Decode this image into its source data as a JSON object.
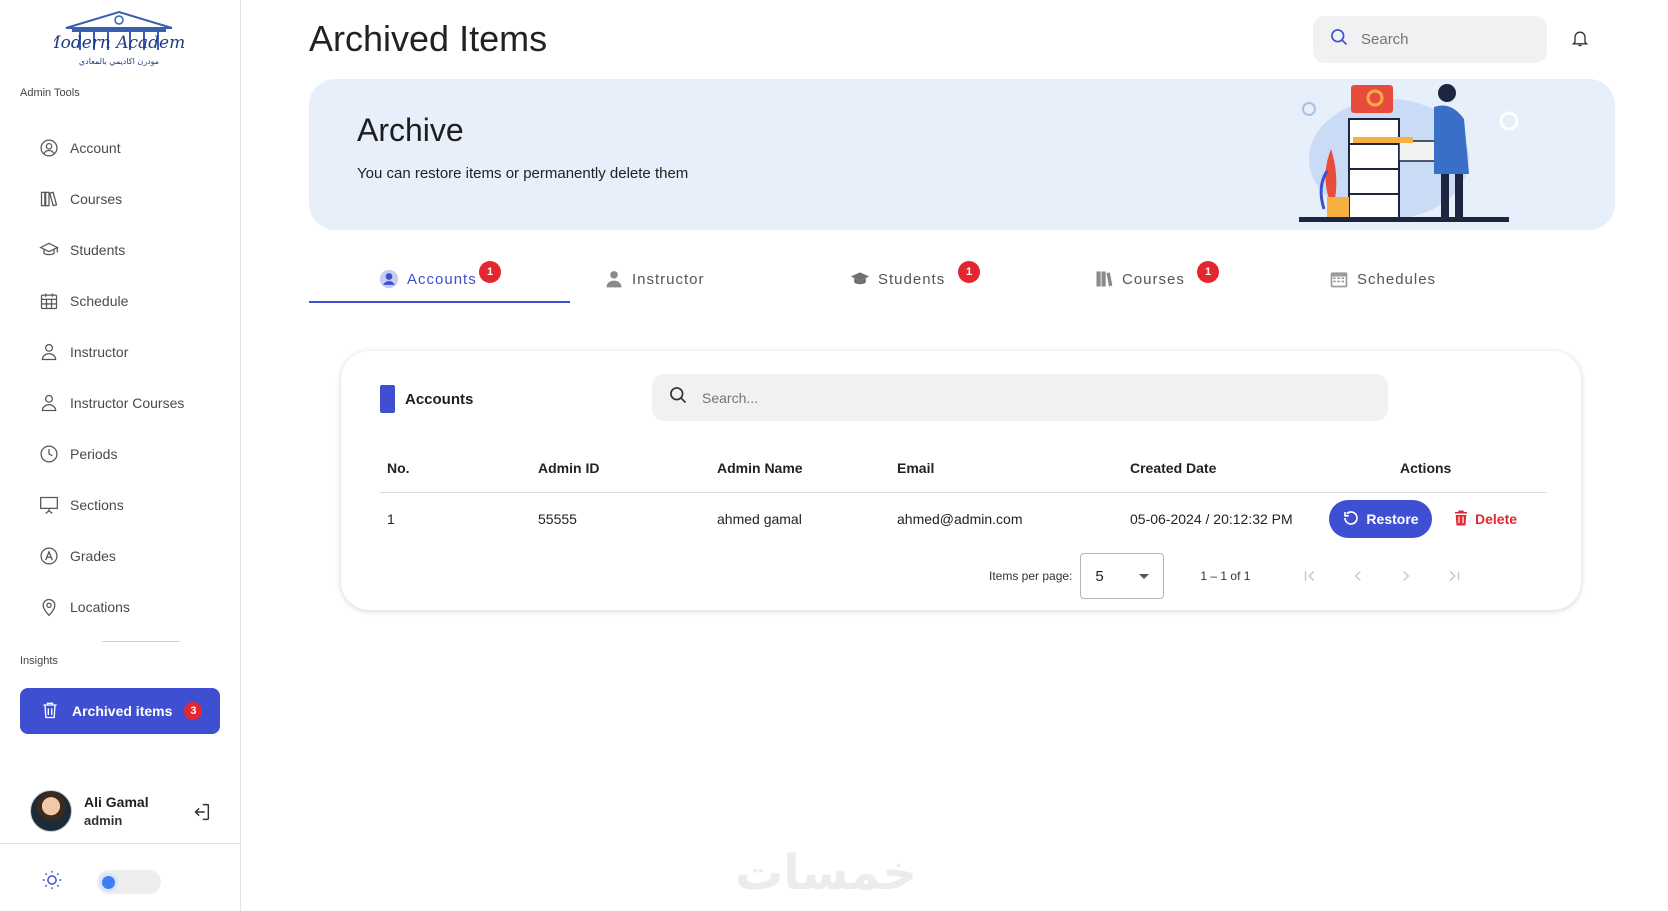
{
  "sidebar": {
    "logo_text": "Modern Academy",
    "logo_subtext": "مودرن اكاديمي بالمعادي",
    "admin_tools_label": "Admin Tools",
    "items": [
      {
        "label": "Account",
        "icon": "user-circle-icon"
      },
      {
        "label": "Courses",
        "icon": "books-icon"
      },
      {
        "label": "Students",
        "icon": "graduation-cap-icon"
      },
      {
        "label": "Schedule",
        "icon": "calendar-icon"
      },
      {
        "label": "Instructor",
        "icon": "person-icon"
      },
      {
        "label": "Instructor Courses",
        "icon": "person-icon"
      },
      {
        "label": "Periods",
        "icon": "clock-icon"
      },
      {
        "label": "Sections",
        "icon": "presentation-icon"
      },
      {
        "label": "Grades",
        "icon": "grade-a-icon"
      },
      {
        "label": "Locations",
        "icon": "location-pin-icon"
      }
    ],
    "insights_label": "Insights",
    "archived": {
      "label": "Archived items",
      "count": "3"
    },
    "user": {
      "name": "Ali Gamal",
      "role": "admin"
    }
  },
  "header": {
    "title": "Archived Items",
    "search_placeholder": "Search"
  },
  "banner": {
    "title": "Archive",
    "subtitle": "You can restore items or permanently delete them"
  },
  "tabs": [
    {
      "label": "Accounts",
      "badge": "1",
      "active": true
    },
    {
      "label": "Instructor",
      "badge": null
    },
    {
      "label": "Students",
      "badge": "1"
    },
    {
      "label": "Courses",
      "badge": "1"
    },
    {
      "label": "Schedules",
      "badge": null
    }
  ],
  "card": {
    "title": "Accounts",
    "search_placeholder": "Search...",
    "columns": [
      "No.",
      "Admin ID",
      "Admin Name",
      "Email",
      "Created Date",
      "Actions"
    ],
    "rows": [
      {
        "no": "1",
        "admin_id": "55555",
        "admin_name": "ahmed gamal",
        "email": "ahmed@admin.com",
        "created": "05-06-2024 / 20:12:32 PM"
      }
    ],
    "restore_label": "Restore",
    "delete_label": "Delete",
    "pager": {
      "items_per_page_label": "Items per page:",
      "page_size": "5",
      "range": "1 – 1 of 1"
    }
  },
  "colors": {
    "accent": "#3f4fd1",
    "danger": "#e3262f",
    "banner_bg": "#e7effb"
  },
  "watermark": "خمسات"
}
